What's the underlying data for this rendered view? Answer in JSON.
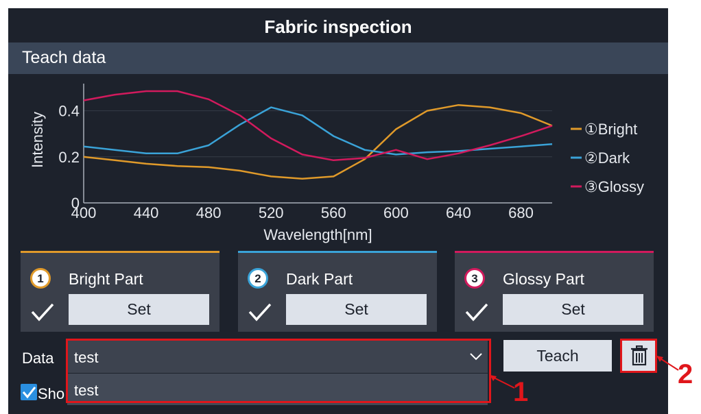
{
  "window": {
    "title": "Fabric inspection"
  },
  "section": {
    "title": "Teach data"
  },
  "chart_data": {
    "type": "line",
    "xlabel": "Wavelength[nm]",
    "ylabel": "Intensity",
    "xlim": [
      400,
      700
    ],
    "ylim": [
      0,
      0.5
    ],
    "x_ticks": [
      "400",
      "440",
      "480",
      "520",
      "560",
      "600",
      "640",
      "680"
    ],
    "y_ticks": [
      "0",
      "0.2",
      "0.4"
    ],
    "legend_position": "right",
    "x": [
      400,
      420,
      440,
      460,
      480,
      500,
      520,
      540,
      560,
      580,
      600,
      620,
      640,
      660,
      680,
      700
    ],
    "series": [
      {
        "name": "①Bright",
        "color": "#e09a2a",
        "values": [
          0.2,
          0.185,
          0.17,
          0.16,
          0.155,
          0.14,
          0.115,
          0.105,
          0.115,
          0.19,
          0.32,
          0.4,
          0.425,
          0.415,
          0.39,
          0.335
        ]
      },
      {
        "name": "②Dark",
        "color": "#3aa3d8",
        "values": [
          0.245,
          0.23,
          0.215,
          0.215,
          0.25,
          0.34,
          0.415,
          0.38,
          0.29,
          0.23,
          0.21,
          0.22,
          0.225,
          0.235,
          0.245,
          0.255
        ]
      },
      {
        "name": "③Glossy",
        "color": "#d21a5d",
        "values": [
          0.445,
          0.47,
          0.485,
          0.485,
          0.45,
          0.38,
          0.28,
          0.21,
          0.185,
          0.195,
          0.23,
          0.19,
          0.215,
          0.25,
          0.29,
          0.335
        ]
      }
    ]
  },
  "parts": [
    {
      "number": "1",
      "name": "Bright Part",
      "set_label": "Set",
      "color": "#e09a2a"
    },
    {
      "number": "2",
      "name": "Dark Part",
      "set_label": "Set",
      "color": "#3aa3d8"
    },
    {
      "number": "3",
      "name": "Glossy Part",
      "set_label": "Set",
      "color": "#d21a5d"
    }
  ],
  "data_field": {
    "label": "Data",
    "selected": "test",
    "options": [
      "test"
    ]
  },
  "buttons": {
    "teach": "Teach"
  },
  "show_checkbox": {
    "label": "Sho",
    "checked": true
  },
  "icons": {
    "delete": "trash-icon",
    "dropdown": "chevron-down-icon",
    "check": "checkmark-icon"
  },
  "callouts": [
    "1",
    "2"
  ],
  "colors": {
    "highlight": "#e0161b",
    "background": "#1d222c",
    "header": "#3a4658"
  }
}
